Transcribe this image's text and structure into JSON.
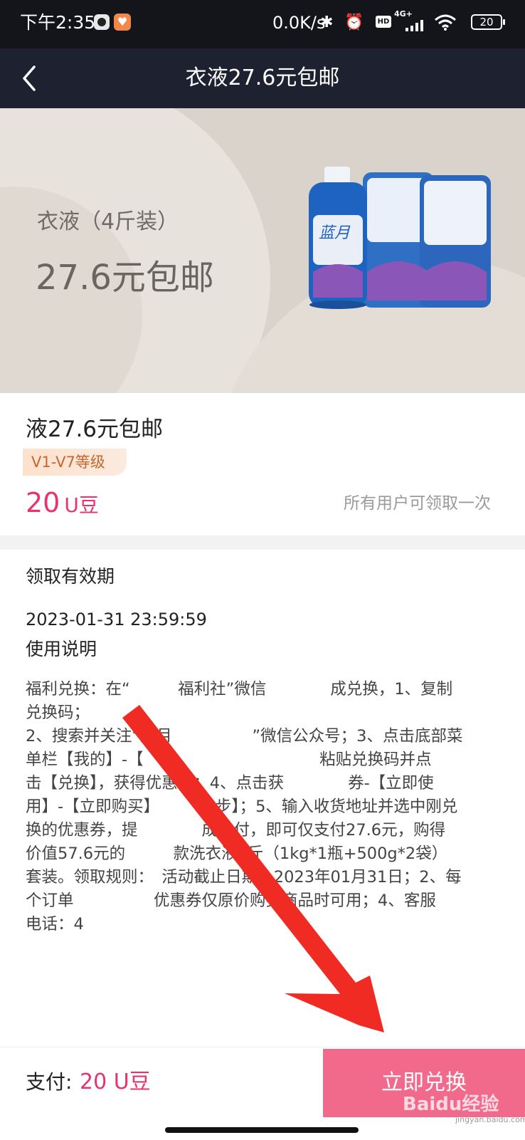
{
  "status_bar": {
    "time": "下午2:35",
    "speed": "0.0K/s",
    "network": "4G+",
    "hd": "HD",
    "battery": "20",
    "icons": [
      "bluetooth-icon",
      "alarm-icon",
      "hd-icon",
      "signal-icon",
      "wifi-icon",
      "battery-icon"
    ]
  },
  "nav": {
    "title": "衣液27.6元包邮",
    "back_icon": "chevron-left-icon"
  },
  "banner": {
    "subtitle": "衣液（4斤装）",
    "price": "27.6元包邮",
    "bottle_brand": "蓝月"
  },
  "product": {
    "title": "液27.6元包邮",
    "level_badge": "V1-V7等级",
    "price_value": "20",
    "price_unit": "U豆",
    "limit": "所有用户可领取一次"
  },
  "detail": {
    "validity_heading": "领取有效期",
    "validity_date": "2023-01-31 23:59:59",
    "usage_heading": "使用说明",
    "usage_lines": [
      "福利兑换：在“　　　福利社”微信　　　　成兑换，1、复制",
      "兑换码；",
      "2、搜索并关注“蓝月　　　　　”微信公众号；3、点击底部菜",
      "单栏【我的】-【　换　　　　　　　　　粘贴兑换码并点",
      "击【兑换】，获得优惠券；4、点击获　　　　券-【立即使",
      "用】-【立即购买】　　　　步】；5、输入收货地址并选中刚兑",
      "换的优惠券，提　　　　成支付，即可仅支付27.6元，购得",
      "价值57.6元的　　　款洗衣液4斤（1kg*1瓶+500g*2袋）",
      "套装。领取规则：　活动截止日期：2023年01月31日；2、每",
      "个订单　　　　　优惠券仅原价购买商品时可用；4、客服",
      "电话：4"
    ]
  },
  "footer": {
    "pay_label": "支付:",
    "pay_amount": "20 U豆",
    "redeem_button": "立即兑换"
  },
  "colors": {
    "accent": "#e8336d",
    "button": "#f16a8c",
    "navbar": "#1e2130",
    "status_bar": "#14151b",
    "badge_text": "#c4682e",
    "annotation_arrow": "#ef2b24"
  },
  "watermark": {
    "text": "Baidu经验",
    "sub": "jingyan.baidu.com"
  }
}
